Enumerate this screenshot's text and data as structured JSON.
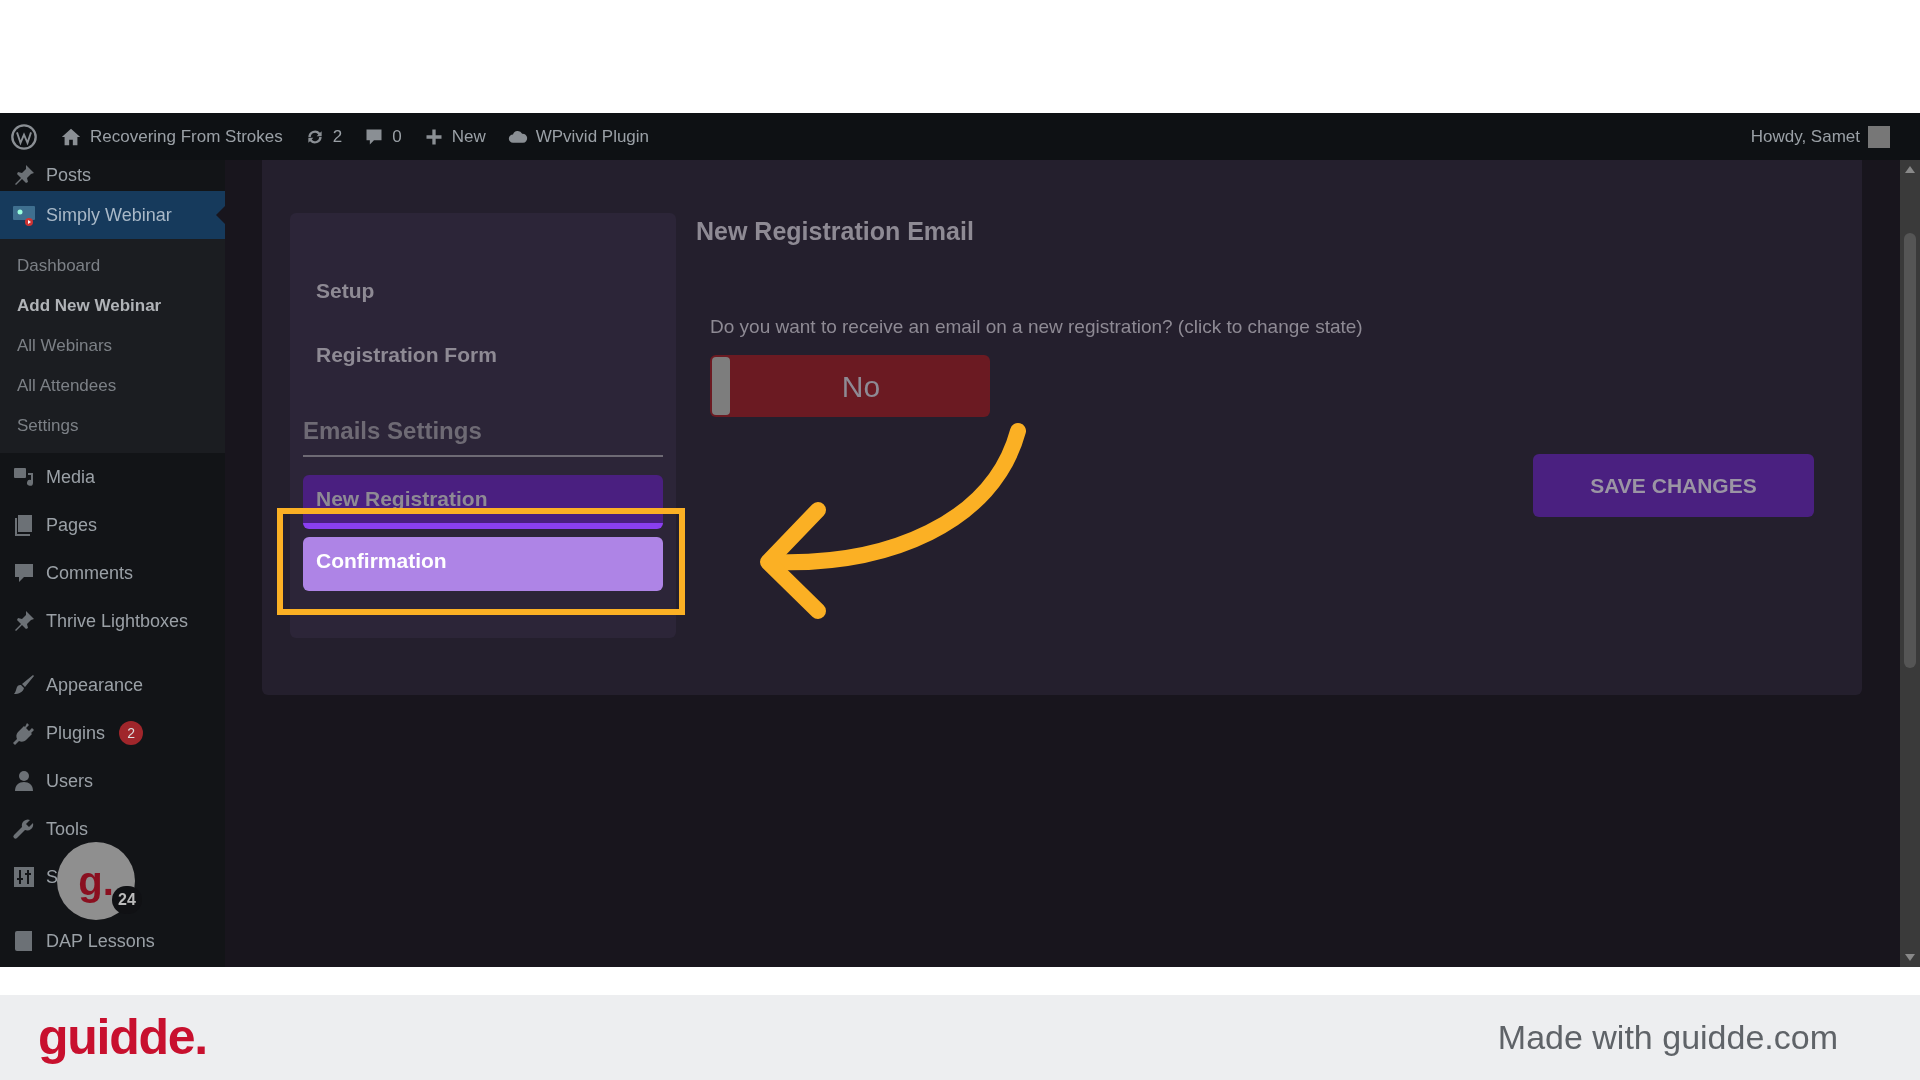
{
  "admin_bar": {
    "items": [
      {
        "kind": "logo"
      },
      {
        "kind": "home",
        "label": "Recovering From Strokes"
      },
      {
        "kind": "updates",
        "label": "2"
      },
      {
        "kind": "comments",
        "label": "0"
      },
      {
        "kind": "new",
        "label": "New"
      },
      {
        "kind": "cloud",
        "label": "WPvivid Plugin"
      }
    ],
    "greeting": "Howdy, Samet"
  },
  "sidebar": {
    "items": [
      {
        "label": "Posts",
        "selected": false
      },
      {
        "label": "Simply Webinar",
        "selected": true,
        "children": [
          {
            "label": "Dashboard",
            "current": false
          },
          {
            "label": "Add New Webinar",
            "current": true
          },
          {
            "label": "All Webinars",
            "current": false
          },
          {
            "label": "All Attendees",
            "current": false
          },
          {
            "label": "Settings",
            "current": false
          }
        ]
      },
      {
        "label": "Media",
        "selected": false
      },
      {
        "label": "Pages",
        "selected": false
      },
      {
        "label": "Comments",
        "selected": false
      },
      {
        "label": "Thrive Lightboxes",
        "selected": false
      },
      {
        "label": "Appearance",
        "selected": false
      },
      {
        "label": "Plugins",
        "selected": false,
        "badge": "2"
      },
      {
        "label": "Users",
        "selected": false
      },
      {
        "label": "Tools",
        "selected": false
      },
      {
        "label": "S",
        "selected": false
      },
      {
        "label": "DAP Lessons",
        "selected": false
      }
    ]
  },
  "floating_badge": {
    "letter": "g.",
    "count": "24"
  },
  "settings_nav": [
    {
      "kind": "link",
      "label": "Setup"
    },
    {
      "kind": "link",
      "label": "Registration Form"
    },
    {
      "kind": "heading",
      "label": "Emails Settings"
    },
    {
      "kind": "tab",
      "label": "New Registration",
      "selected": true,
      "hovered": false
    },
    {
      "kind": "tab",
      "label": "Confirmation",
      "selected": false,
      "hovered": true
    }
  ],
  "panel": {
    "title": "New Registration Email",
    "question": "Do you want to receive an email on a new registration? (click to change state)",
    "toggle": {
      "label": "No",
      "on": false
    },
    "save_button": "SAVE CHANGES"
  },
  "footer": {
    "logo": "guidde.",
    "credit": "Made with guidde.com"
  }
}
